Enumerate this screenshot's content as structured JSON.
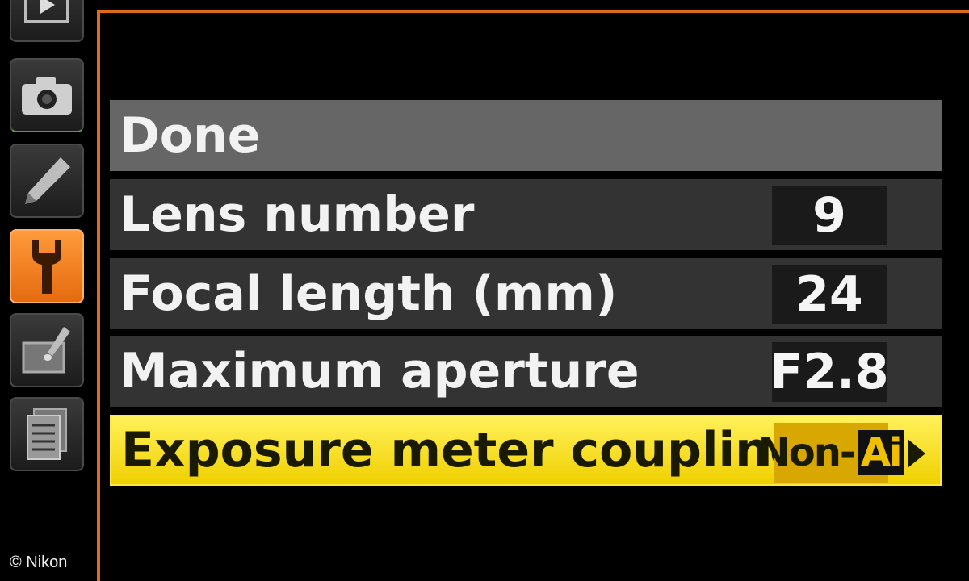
{
  "menu": {
    "rows": [
      {
        "label": "Done",
        "value": ""
      },
      {
        "label": "Lens number",
        "value": "9"
      },
      {
        "label": "Focal length (mm)",
        "value": "24"
      },
      {
        "label": "Maximum aperture",
        "value": "F2.8"
      },
      {
        "label": "Exposure meter coupling",
        "value_prefix": "Non-",
        "value_badge": "Ai"
      }
    ]
  },
  "sidebar": {
    "tabs": [
      {
        "icon": "playback-icon"
      },
      {
        "icon": "camera-icon"
      },
      {
        "icon": "pencil-icon"
      },
      {
        "icon": "wrench-icon",
        "active": true
      },
      {
        "icon": "retouch-brush-icon"
      },
      {
        "icon": "recent-settings-icon"
      }
    ]
  },
  "footer": {
    "copyright": "© Nikon"
  },
  "colors": {
    "accent_orange": "#e06a1a",
    "highlight_yellow": "#f0d000",
    "row_gray": "#333333",
    "done_gray": "#666666"
  }
}
